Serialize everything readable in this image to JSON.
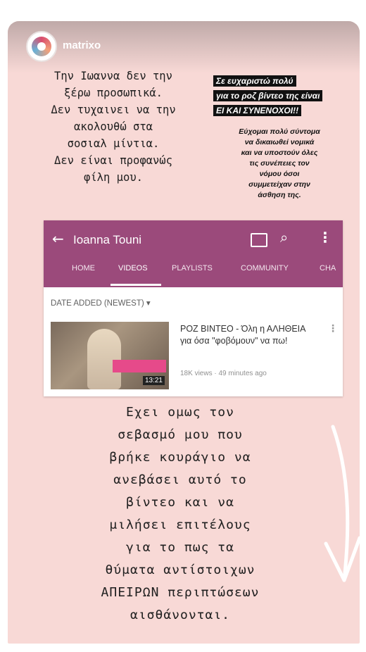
{
  "story": {
    "username": "matrixo",
    "left_text": "Την Ιωαννα δεν την\nξέρω προσωπικά.\nΔεν τυχαινει να την\nακολουθώ στα\nσοσιαλ μίντια.\nΔεν είναι προφανώς\nφίλη μου.",
    "highlight_lines": [
      "Σε ευχαριστώ πολύ",
      "για το ροζ βίντεο της είναι",
      "ΕΙ ΚΑΙ ΣΥΝΕΝΟΧΟΙ!!"
    ],
    "small_text": "Εύχομαι πολύ σύντομα\nνα δικαιωθεί νομικά\nκαι να υποστούν όλες\nτις συνέπειες τον\nνόμου όσοι\nσυμμετείχαν στην\nάσθηση της.",
    "bottom_text": "Εχει ομως τον\nσεβασμό μου που\nβρήκε κουράγιο να\nανεβάσει αυτό το\nβίντεο και να\nμιλήσει επιτέλους\nγια το πως τα\nθύματα αντίστοιχων\nΑΠΕΙΡΩΝ περιπτώσεων\nαισθάνονται."
  },
  "youtube": {
    "channel_title": "Ioanna Touni",
    "tabs": [
      "HOME",
      "VIDEOS",
      "PLAYLISTS",
      "COMMUNITY",
      "CHA"
    ],
    "active_tab": "VIDEOS",
    "sort_label": "DATE ADDED (NEWEST) ▾",
    "video": {
      "title": "ΡΟΖ ΒΙΝΤΕΟ - Όλη η ΑΛΗΘΕΙΑ για όσα \"φοβόμουν\" να πω!",
      "meta": "18K views · 49 minutes ago",
      "duration": "13:21"
    }
  },
  "colors": {
    "story_background": "#f8d9d6",
    "youtube_header": "#9b4a7b",
    "highlight_bg": "#111111"
  }
}
